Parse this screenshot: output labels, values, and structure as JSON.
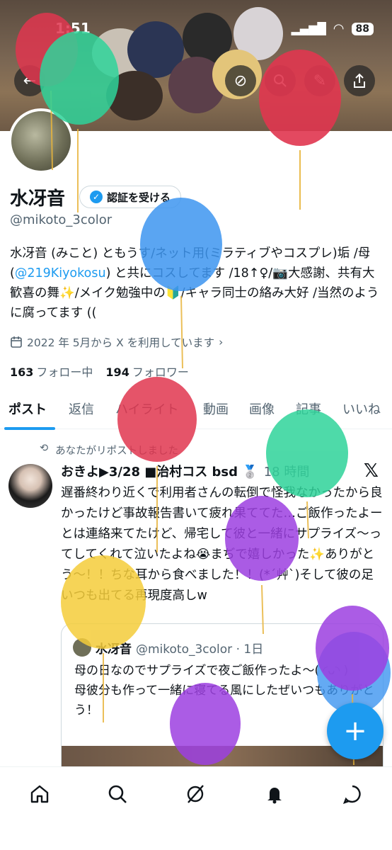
{
  "status_bar": {
    "time": "1:51",
    "battery": "88"
  },
  "profile": {
    "name": "水冴音",
    "verify_label": "認証を受ける",
    "handle": "@mikoto_3color",
    "bio_part1": "水冴音 (みこと) ともうす/ネット用(ミラティブやコスプレ)垢 /母 (",
    "bio_link": "@219Kiyokosu",
    "bio_part2": ") と共にコスしてます /18↑♀/📷大感謝、共有大歓喜の舞✨/メイク勉強中の🔰/キャラ同士の絡み大好 /当然のように腐ってます ((",
    "joined": "2022 年 5月から X を利用しています",
    "following_count": "163",
    "following_label": "フォロー中",
    "followers_count": "194",
    "followers_label": "フォロワー"
  },
  "tabs": [
    "ポスト",
    "返信",
    "ハイライト",
    "動画",
    "画像",
    "記事",
    "いいね"
  ],
  "tweet": {
    "repost_label": "あなたがリポストしました",
    "author": "おきよ▶3/28 ■治村コス bsd 🥈",
    "time_ago": "18 時間",
    "text": "遅番終わり近くで利用者さんの転倒で怪我なかったから良かったけど事故報告書いて疲れ果ててた…ご飯作ったよーとは連絡来てたけど、帰宅して彼と一緒にサプライズ〜ってしてくれて泣いたよね😭まぢで嬉しかった✨ありがとう〜！！ちな耳から食べました！！(*´艸`)そして彼の足いつも出てる再現度高しw",
    "quote_author": "水冴音",
    "quote_handle": "@mikoto_3color · 1日",
    "quote_text": "母の日なのでサプライズで夜ご飯作ったよ〜( ◜ᴗ◝ )\n母彼分も作って一緒に寝てる風にしたぜいつもありがとう！"
  },
  "icons": {
    "back": "back-arrow-icon",
    "grok": "grok-icon",
    "search": "search-icon",
    "edit": "pencil-icon",
    "share": "share-icon",
    "calendar": "calendar-icon",
    "repost": "repost-icon",
    "x_logo": "x-logo-icon",
    "compose": "plus-icon",
    "nav": [
      "home-icon",
      "search-icon",
      "grok-icon",
      "bell-icon",
      "messages-icon"
    ]
  },
  "colors": {
    "accent": "#1d9bf0",
    "text": "#0f1419",
    "muted": "#536471"
  }
}
